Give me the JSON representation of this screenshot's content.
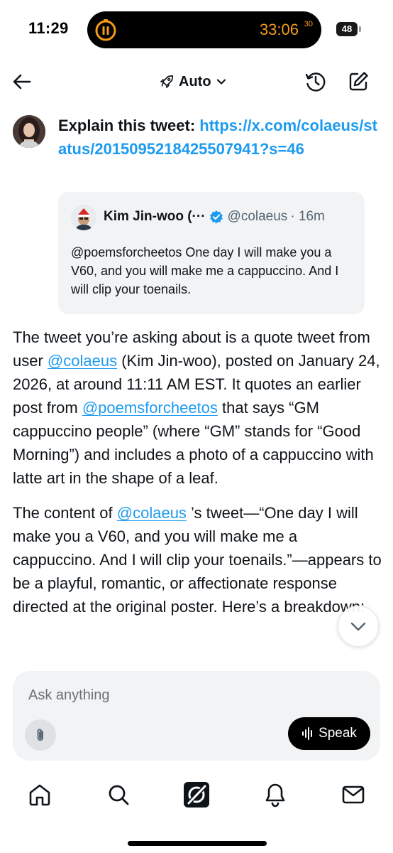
{
  "status_bar": {
    "time": "11:29",
    "timer": "33:06",
    "timer_fraction": "30",
    "battery": "48",
    "timer_color": "#f59b1c"
  },
  "header": {
    "mode_label": "Auto",
    "icons": [
      "back-arrow-icon",
      "rocket-icon",
      "chevron-down-icon",
      "history-icon",
      "compose-icon"
    ]
  },
  "prompt": {
    "text": "Explain this tweet:",
    "link": "https://x.com/colaeus/status/2015095218425507941?s=46"
  },
  "quoted_tweet": {
    "author": "Kim Jin-woo (···",
    "handle": "@colaeus",
    "time": "· 16m",
    "text": "@poemsforcheetos One day I will make you a V60, and you will make me a cappuccino. And I will clip your toenails."
  },
  "answer": {
    "p1_a": "The tweet you’re asking about is a quote tweet from user ",
    "p1_mention1": "@colaeus",
    "p1_b": " (Kim Jin-woo), posted on January 24, 2026, at around 11:11 AM EST. It quotes an earlier post from ",
    "p1_mention2": "@poemsforcheetos",
    "p1_c": " that says “GM cappuccino people” (where “GM” stands for “Good Morning”) and includes a photo of a cappuccino with latte art in the shape of a leaf.",
    "p2_a": "The content of ",
    "p2_mention": "@colaeus",
    "p2_b": " ’s tweet—“One day I will make you a V60, and you will make me a cappuccino. And I will clip your toenails.”—appears to be a playful, romantic, or affectionate response directed at the original poster. Here’s a breakdown:"
  },
  "composer": {
    "placeholder": "Ask anything",
    "value": "",
    "speak_label": "Speak"
  },
  "tab_bar": {
    "tabs": [
      "home-icon",
      "search-icon",
      "grok-icon",
      "notifications-icon",
      "messages-icon"
    ],
    "active": "grok-icon"
  },
  "colors": {
    "link": "#1d9bf0",
    "text": "#0f1419",
    "muted": "#536471",
    "card_bg": "#f2f3f4"
  }
}
